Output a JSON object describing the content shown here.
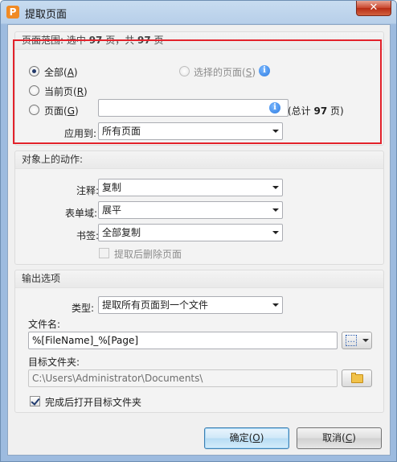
{
  "window": {
    "title": "提取页面",
    "close_label": "✕",
    "app_icon_letter": "P"
  },
  "page_range": {
    "header": "页面范围: 选中 97 页，共 97 页",
    "header_pre": "页面范围: 选中 ",
    "header_sel": "97",
    "header_mid": " 页，共 ",
    "header_total": "97",
    "header_post": " 页",
    "all": {
      "label": "全部",
      "key": "A",
      "selected": true
    },
    "selected_pages": {
      "label": "选择的页面",
      "key": "S",
      "enabled": false
    },
    "current_page": {
      "label": "当前页",
      "key": "R"
    },
    "pages": {
      "label": "页面",
      "key": "G",
      "value": ""
    },
    "total_pre": "(总计 ",
    "total": "97",
    "total_post": " 页)",
    "apply_to_label": "应用到:",
    "apply_to_value": "所有页面"
  },
  "actions": {
    "header": "对象上的动作:",
    "annotations_label": "注释:",
    "annotations_value": "复制",
    "form_fields_label": "表单域:",
    "form_fields_value": "展平",
    "bookmarks_label": "书签:",
    "bookmarks_value": "全部复制",
    "delete_after_label": "提取后删除页面",
    "delete_after_checked": false
  },
  "output": {
    "header": "输出选项",
    "type_label": "类型:",
    "type_value": "提取所有页面到一个文件",
    "filename_label": "文件名:",
    "filename_value": "%[FileName]_%[Page]",
    "folder_label": "目标文件夹:",
    "folder_value": "C:\\Users\\Administrator\\Documents\\",
    "open_after_label": "完成后打开目标文件夹",
    "open_after_checked": true
  },
  "buttons": {
    "ok": {
      "label": "确定",
      "key": "O"
    },
    "cancel": {
      "label": "取消",
      "key": "C"
    }
  }
}
